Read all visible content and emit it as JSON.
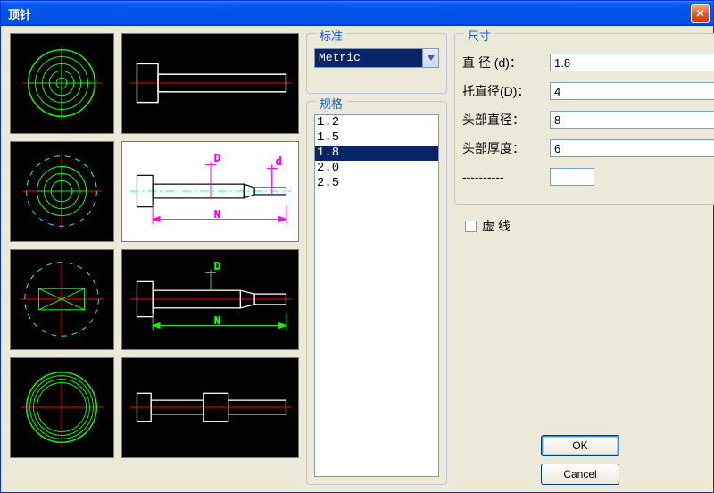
{
  "window": {
    "title": "顶针"
  },
  "groups": {
    "standard": "标准",
    "spec": "规格",
    "dim": "尺寸"
  },
  "standard": {
    "selected": "Metric"
  },
  "spec": {
    "options": [
      "1.2",
      "1.5",
      "1.8",
      "2.0",
      "2.5"
    ],
    "selected": "1.8"
  },
  "dim": {
    "labels": {
      "diameter": "直  径 (d)：",
      "shoulder": "托直径(D)：",
      "head_dia": "头部直径：",
      "head_thk": "头部厚度：",
      "extra": "----------"
    },
    "values": {
      "diameter": "1.8",
      "shoulder": "4",
      "head_dia": "8",
      "head_thk": "6",
      "extra": ""
    }
  },
  "dashed": {
    "label": "虚  线",
    "checked": false
  },
  "buttons": {
    "ok": "OK",
    "cancel": "Cancel"
  }
}
